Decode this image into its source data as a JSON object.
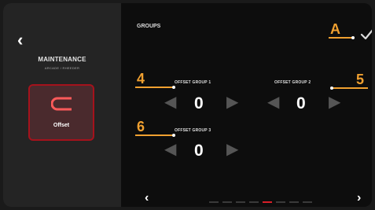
{
  "left_panel": {
    "back_icon": "chevron-left-icon",
    "title": "MAINTENANCE",
    "subtitle": "ARCADE / RHEEDER",
    "tile": {
      "label": "Offset",
      "icon": "offset-bracket-icon"
    }
  },
  "screen": {
    "title": "GROUPS",
    "confirm_icon": "check-icon"
  },
  "groups": [
    {
      "label": "OFFSET GROUP 1",
      "value": "0",
      "annotation": "4"
    },
    {
      "label": "OFFSET GROUP 2",
      "value": "0",
      "annotation": "5"
    },
    {
      "label": "OFFSET GROUP 3",
      "value": "0",
      "annotation": "6"
    }
  ],
  "annotations": {
    "confirm": "A"
  },
  "footer": {
    "prev_icon": "chevron-left-icon",
    "next_icon": "chevron-right-icon",
    "pages": 8,
    "active_page": 4
  },
  "colors": {
    "accent": "#d71f28",
    "annotation": "#f0a030",
    "panel": "#242424",
    "background": "#0d0d0d"
  }
}
